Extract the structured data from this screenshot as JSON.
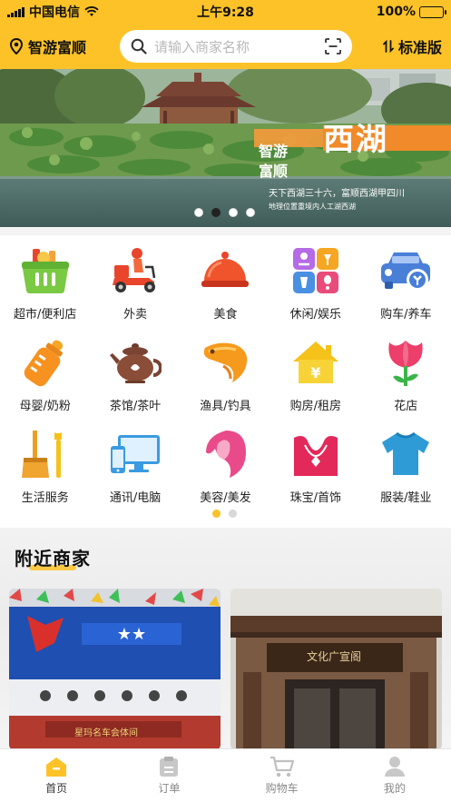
{
  "status_bar": {
    "carrier": "中国电信",
    "time": "上午9:28",
    "battery": "100%"
  },
  "header": {
    "location": "智游富顺",
    "search_placeholder": "请输入商家名称",
    "version_label": "标准版"
  },
  "banner": {
    "title": "西湖",
    "side_text": "智游富顺",
    "line1": "天下西湖三十六，富顺西湖甲四川",
    "line2": "地理位置重境内人工湖西湖",
    "slide_count": 4,
    "active_slide": 1
  },
  "categories": [
    {
      "label": "超市/便利店",
      "icon": "basket-icon"
    },
    {
      "label": "外卖",
      "icon": "delivery-scooter-icon"
    },
    {
      "label": "美食",
      "icon": "food-cloche-icon"
    },
    {
      "label": "休闲/娱乐",
      "icon": "leisure-grid-icon"
    },
    {
      "label": "购车/养车",
      "icon": "car-icon"
    },
    {
      "label": "母婴/奶粉",
      "icon": "baby-bottle-icon"
    },
    {
      "label": "茶馆/茶叶",
      "icon": "teapot-icon"
    },
    {
      "label": "渔具/钓具",
      "icon": "fish-icon"
    },
    {
      "label": "购房/租房",
      "icon": "house-icon"
    },
    {
      "label": "花店",
      "icon": "tulip-icon"
    },
    {
      "label": "生活服务",
      "icon": "tools-icon"
    },
    {
      "label": "通讯/电脑",
      "icon": "devices-icon"
    },
    {
      "label": "美容/美发",
      "icon": "beauty-icon"
    },
    {
      "label": "珠宝/首饰",
      "icon": "necklace-icon"
    },
    {
      "label": "服装/鞋业",
      "icon": "tshirt-icon"
    }
  ],
  "category_pages": {
    "count": 2,
    "active": 1
  },
  "nearby": {
    "title": "附近商家",
    "shops": [
      {
        "sign": "星玛名车会体间"
      },
      {
        "sign": "文化广宣阁"
      }
    ]
  },
  "tabbar": [
    {
      "label": "首页",
      "icon": "home-icon",
      "active": true
    },
    {
      "label": "订单",
      "icon": "orders-icon",
      "active": false
    },
    {
      "label": "购物车",
      "icon": "cart-icon",
      "active": false
    },
    {
      "label": "我的",
      "icon": "profile-icon",
      "active": false
    }
  ],
  "colors": {
    "brand": "#fcc227",
    "text": "#222222",
    "muted": "#888888"
  }
}
